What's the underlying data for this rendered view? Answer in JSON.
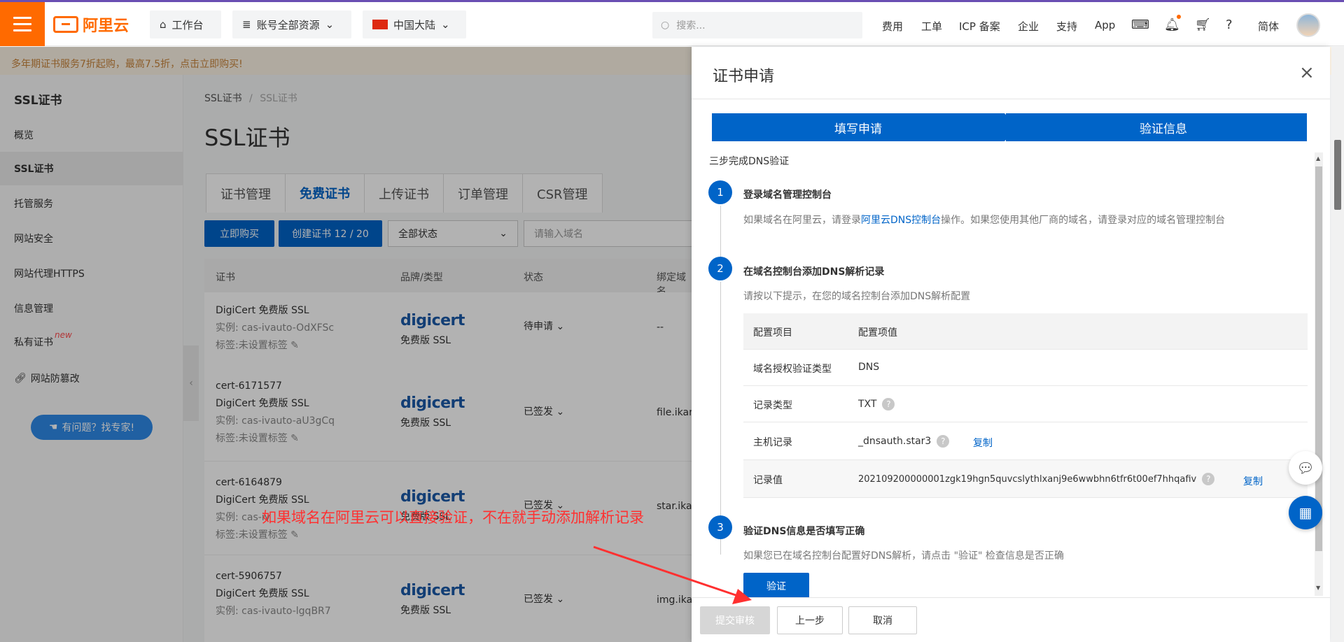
{
  "topbar": {
    "logo_text": "阿里云",
    "workbench": "工作台",
    "resources": "账号全部资源",
    "region": "中国大陆",
    "search_placeholder": "搜索...",
    "links": [
      "费用",
      "工单",
      "ICP 备案",
      "企业",
      "支持",
      "App"
    ],
    "lang": "简体"
  },
  "promo": "多年期证书服务7折起购，最高7.5折，点击立即购买!",
  "sidebar": {
    "title": "SSL证书",
    "items": [
      "概览",
      "SSL证书",
      "托管服务",
      "网站安全",
      "网站代理HTTPS",
      "信息管理",
      "私有证书",
      "网站防篡改"
    ],
    "new_badge": "new",
    "help": "有问题？找专家!"
  },
  "main": {
    "breadcrumb": [
      "SSL证书",
      "/",
      "SSL证书"
    ],
    "title": "SSL证书",
    "tabs": [
      "证书管理",
      "免费证书",
      "上传证书",
      "订单管理",
      "CSR管理"
    ],
    "buy_btn": "立即购买",
    "create_btn": "创建证书 12 / 20",
    "status_select": "全部状态",
    "domain_placeholder": "请输入域名",
    "columns": [
      "证书",
      "品牌/类型",
      "状态",
      "绑定域名"
    ],
    "rows": [
      {
        "id": "",
        "name": "DigiCert 免费版 SSL",
        "instance": "实例: cas-ivauto-OdXFSc",
        "tag": "标签:未设置标签",
        "brand": "digicert",
        "brand_type": "免费版 SSL",
        "status": "待申请",
        "bind": "--"
      },
      {
        "id": "cert-6171577",
        "name": "DigiCert 免费版 SSL",
        "instance": "实例: cas-ivauto-aU3gCq",
        "tag": "标签:未设置标签",
        "brand": "digicert",
        "brand_type": "免费版 SSL",
        "status": "已签发",
        "bind": "file.ikar"
      },
      {
        "id": "cert-6164879",
        "name": "DigiCert 免费版 SSL",
        "instance": "实例: cas-iv",
        "tag": "标签:未设置标签",
        "brand": "digicert",
        "brand_type": "免费版 SSL",
        "status": "已签发",
        "bind": "star.ikar"
      },
      {
        "id": "cert-5906757",
        "name": "DigiCert 免费版 SSL",
        "instance": "实例: cas-ivauto-lgqBR7",
        "tag": "",
        "brand": "digicert",
        "brand_type": "免费版 SSL",
        "status": "已签发",
        "bind": "img.ikar"
      }
    ]
  },
  "drawer": {
    "title": "证书申请",
    "steps": [
      "填写申请",
      "验证信息"
    ],
    "subtitle": "三步完成DNS验证",
    "step1": {
      "num": "1",
      "head": "登录域名管理控制台",
      "desc_pre": "如果域名在阿里云，请登录",
      "desc_link": "阿里云DNS控制台",
      "desc_post": "操作。如果您使用其他厂商的域名，请登录对应的域名管理控制台"
    },
    "step2": {
      "num": "2",
      "head": "在域名控制台添加DNS解析记录",
      "desc": "请按以下提示，在您的域名控制台添加DNS解析配置",
      "table_head": [
        "配置项目",
        "配置项值"
      ],
      "rows": [
        {
          "k": "域名授权验证类型",
          "v": "DNS"
        },
        {
          "k": "记录类型",
          "v": "TXT"
        },
        {
          "k": "主机记录",
          "v": "_dnsauth.star3"
        },
        {
          "k": "记录值",
          "v": "202109200000001zgk19hgn5quvcslythlxanj9e6wwbhn6tfr6t00ef7hhqafiv"
        }
      ],
      "copy": "复制"
    },
    "step3": {
      "num": "3",
      "head": "验证DNS信息是否填写正确",
      "desc": "如果您已在域名控制台配置好DNS解析，请点击 \"验证\" 检查信息是否正确",
      "verify": "验证"
    },
    "footer": [
      "提交审核",
      "上一步",
      "取消"
    ]
  },
  "annotation": "如果域名在阿里云可以直接验证，不在就手动添加解析记录",
  "colors": {
    "brand": "#ff6a00",
    "primary": "#0064c8",
    "annotation": "#ff3030"
  }
}
